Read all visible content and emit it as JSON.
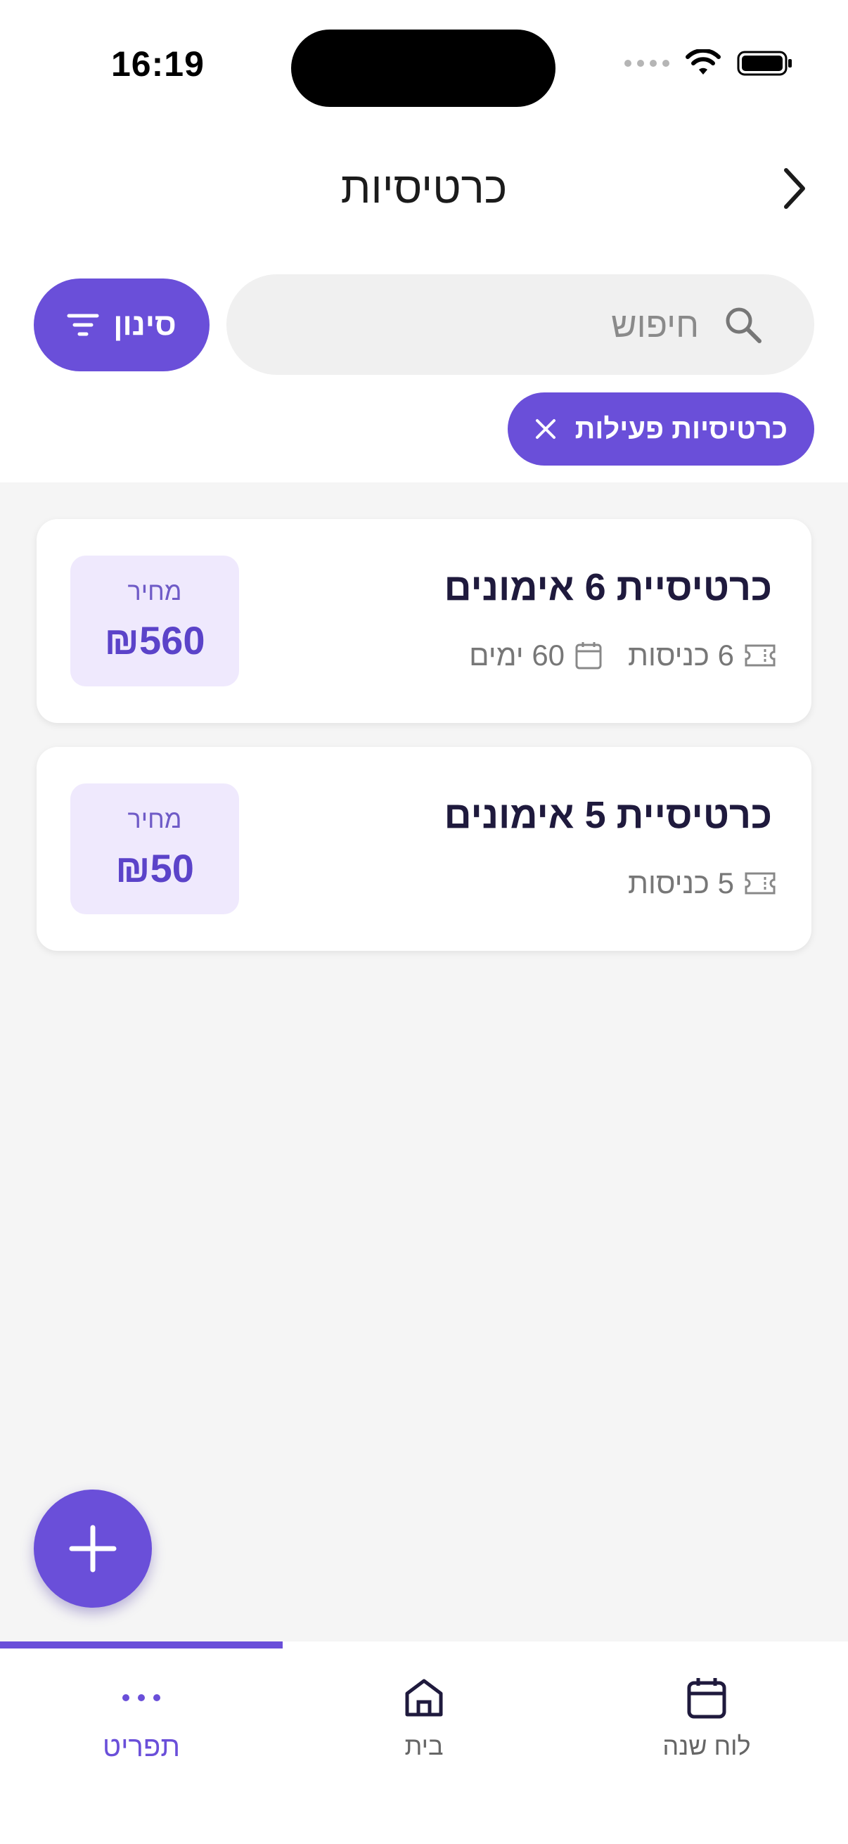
{
  "status_bar": {
    "time": "16:19"
  },
  "header": {
    "title": "כרטיסיות"
  },
  "search": {
    "placeholder": "חיפוש",
    "value": ""
  },
  "filter_button": {
    "label": "סינון"
  },
  "active_filter_chip": {
    "label": "כרטיסיות פעילות"
  },
  "cards": [
    {
      "title": "כרטיסיית 6 אימונים",
      "entries": "6 כניסות",
      "duration": "60 ימים",
      "price_label": "מחיר",
      "price": "₪560"
    },
    {
      "title": "כרטיסיית 5 אימונים",
      "entries": "5 כניסות",
      "price_label": "מחיר",
      "price": "₪50"
    }
  ],
  "bottom_nav": {
    "items": [
      {
        "label": "תפריט",
        "icon": "more-dots-icon",
        "active": true
      },
      {
        "label": "בית",
        "icon": "home-icon",
        "active": false
      },
      {
        "label": "לוח שנה",
        "icon": "calendar-icon",
        "active": false
      }
    ]
  },
  "colors": {
    "accent": "#6a4fd9",
    "price_bg": "#efe9fd",
    "content_bg": "#f5f5f5"
  }
}
